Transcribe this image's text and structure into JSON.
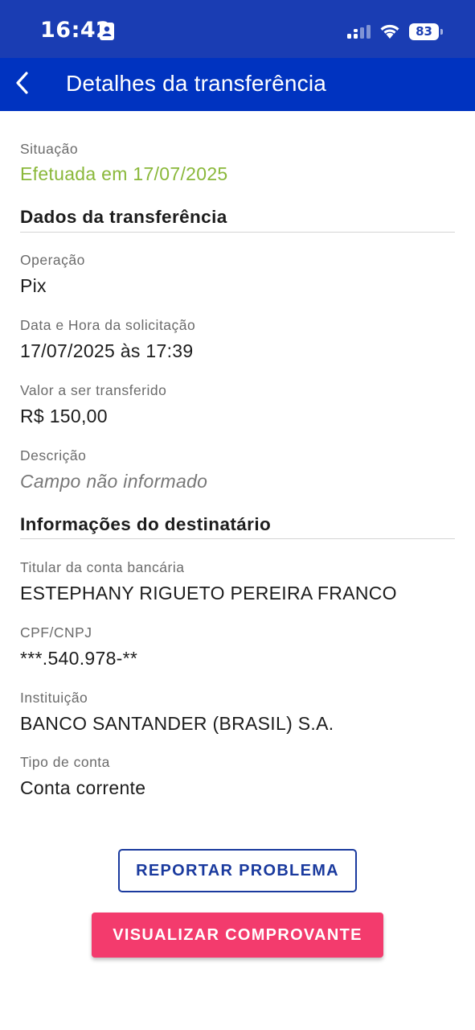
{
  "status_bar": {
    "time": "16:42",
    "battery": "83",
    "icons": [
      "contact-badge-icon",
      "signal-icon",
      "wifi-icon",
      "battery-icon"
    ]
  },
  "header": {
    "title": "Detalhes da transferência",
    "back_icon": "chevron-left-icon"
  },
  "status": {
    "label": "Situação",
    "value": "Efetuada em 17/07/2025"
  },
  "transfer_section": {
    "title": "Dados da transferência",
    "fields": [
      {
        "label": "Operação",
        "value": "Pix"
      },
      {
        "label": "Data e Hora da solicitação",
        "value": "17/07/2025 às 17:39"
      },
      {
        "label": "Valor a ser transferido",
        "value": "R$ 150,00"
      },
      {
        "label": "Descrição",
        "value": "Campo não informado"
      }
    ]
  },
  "recipient_section": {
    "title": "Informações do destinatário",
    "fields": [
      {
        "label": "Titular da conta bancária",
        "value": "ESTEPHANY RIGUETO PEREIRA FRANCO"
      },
      {
        "label": "CPF/CNPJ",
        "value": "***.540.978-**"
      },
      {
        "label": "Instituição",
        "value": "BANCO SANTANDER (BRASIL) S.A."
      },
      {
        "label": "Tipo de conta",
        "value": "Conta corrente"
      }
    ]
  },
  "actions": {
    "report_label": "REPORTAR PROBLEMA",
    "receipt_label": "VISUALIZAR COMPROVANTE"
  },
  "colors": {
    "status_bar": "#1a3db3",
    "app_bar": "#0033c0",
    "success": "#8ab83a",
    "primary_button": "#f33b6d",
    "outline_button": "#1a3a9e"
  }
}
